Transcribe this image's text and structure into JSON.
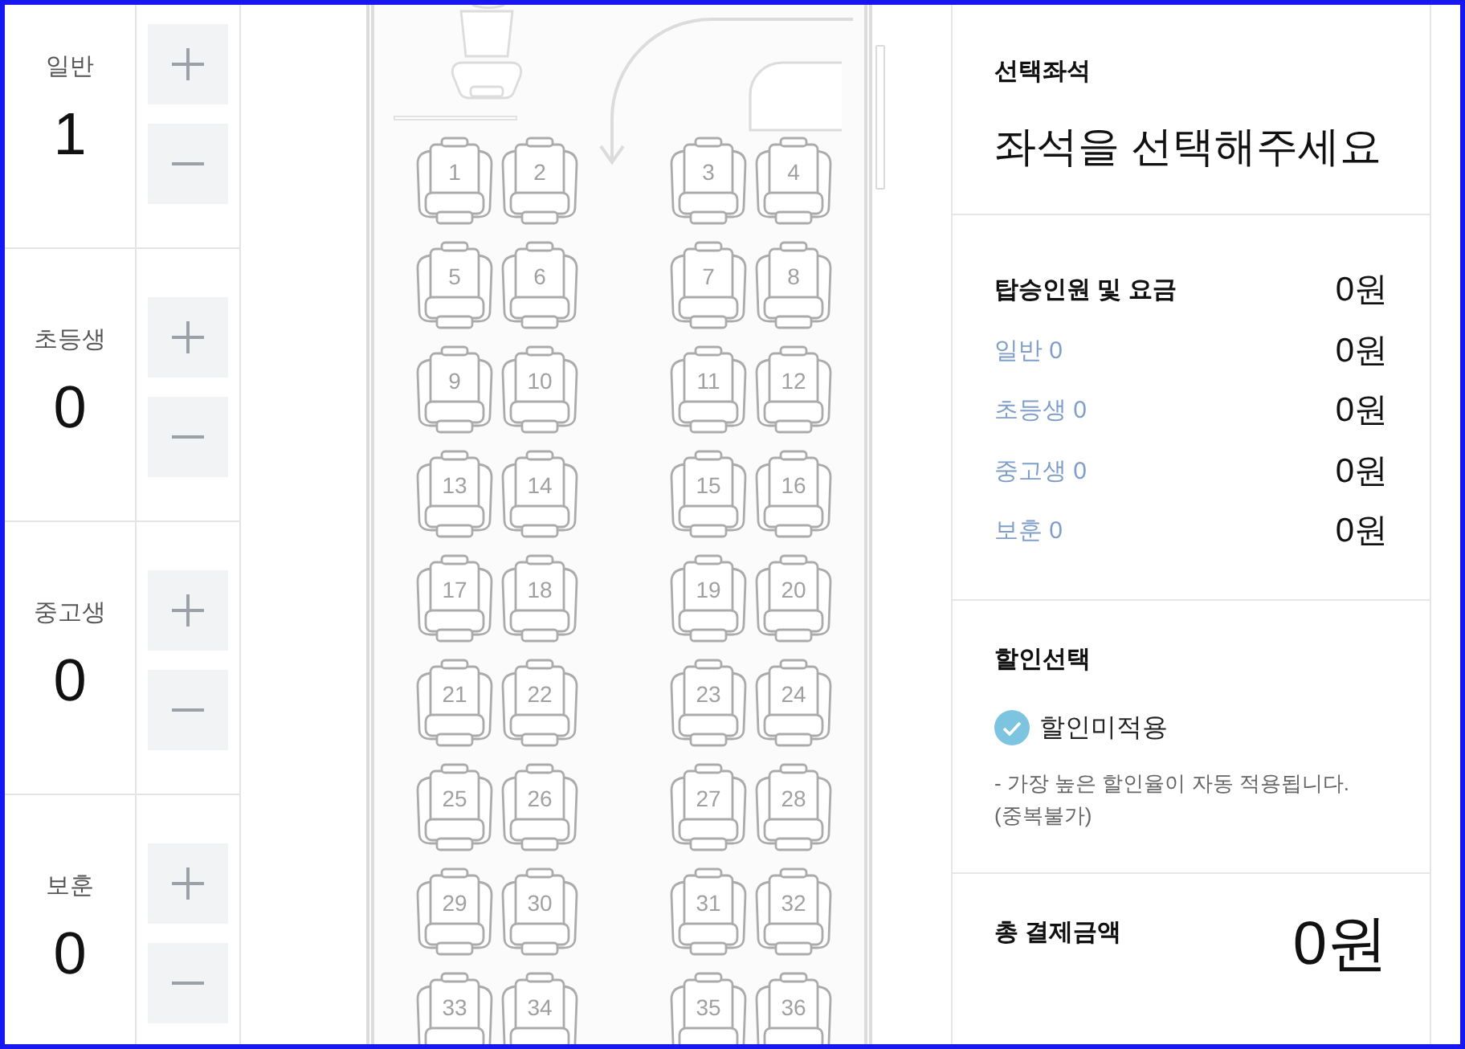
{
  "passenger_types": [
    {
      "label": "일반",
      "count": "1"
    },
    {
      "label": "초등생",
      "count": "0"
    },
    {
      "label": "중고생",
      "count": "0"
    },
    {
      "label": "보훈",
      "count": "0"
    }
  ],
  "seats": [
    {
      "number": "1",
      "selected": false
    },
    {
      "number": "2",
      "selected": false
    },
    {
      "number": "3",
      "selected": false
    },
    {
      "number": "4",
      "selected": false
    },
    {
      "number": "5",
      "selected": false
    },
    {
      "number": "6",
      "selected": false
    },
    {
      "number": "7",
      "selected": false
    },
    {
      "number": "8",
      "selected": false
    },
    {
      "number": "9",
      "selected": false
    },
    {
      "number": "10",
      "selected": false
    },
    {
      "number": "11",
      "selected": false
    },
    {
      "number": "12",
      "selected": false
    },
    {
      "number": "13",
      "selected": false
    },
    {
      "number": "14",
      "selected": false
    },
    {
      "number": "15",
      "selected": false
    },
    {
      "number": "16",
      "selected": false
    },
    {
      "number": "17",
      "selected": false
    },
    {
      "number": "18",
      "selected": false
    },
    {
      "number": "19",
      "selected": false
    },
    {
      "number": "20",
      "selected": false
    },
    {
      "number": "21",
      "selected": false
    },
    {
      "number": "22",
      "selected": false
    },
    {
      "number": "23",
      "selected": false
    },
    {
      "number": "24",
      "selected": false
    },
    {
      "number": "25",
      "selected": false
    },
    {
      "number": "26",
      "selected": false
    },
    {
      "number": "27",
      "selected": false
    },
    {
      "number": "28",
      "selected": false
    },
    {
      "number": "29",
      "selected": false
    },
    {
      "number": "30",
      "selected": false
    },
    {
      "number": "31",
      "selected": false
    },
    {
      "number": "32",
      "selected": false
    },
    {
      "number": "33",
      "selected": false
    },
    {
      "number": "34",
      "selected": false
    },
    {
      "number": "35",
      "selected": false
    },
    {
      "number": "36",
      "selected": false
    }
  ],
  "summary": {
    "selected_seats": {
      "title": "선택좌석",
      "message": "좌석을 선택해주세요"
    },
    "fares": {
      "title": "탑승인원 및 요금",
      "total": "0원",
      "rows": [
        {
          "label": "일반 0",
          "amount": "0원"
        },
        {
          "label": "초등생 0",
          "amount": "0원"
        },
        {
          "label": "중고생 0",
          "amount": "0원"
        },
        {
          "label": "보훈 0",
          "amount": "0원"
        }
      ]
    },
    "discount": {
      "title": "할인선택",
      "option": {
        "label": "할인미적용",
        "checked": true
      },
      "note": "- 가장 높은 할인율이 자동 적용됩니다. (중복불가)"
    },
    "payment": {
      "label": "총 결제금액",
      "amount": "0원"
    }
  }
}
